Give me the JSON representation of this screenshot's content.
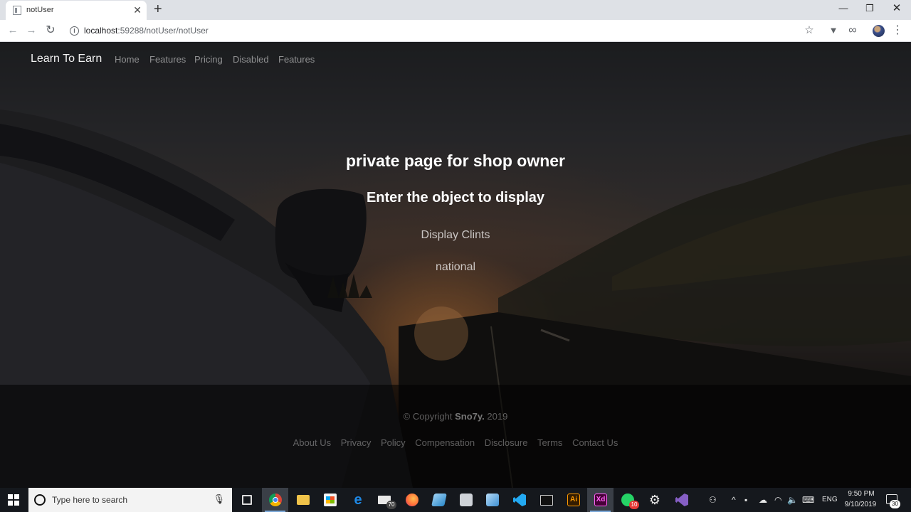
{
  "browser": {
    "tab_title": "notUser",
    "tab_close_glyph": "✕",
    "new_tab_glyph": "+",
    "url_host": "localhost",
    "url_path": ":59288/notUser/notUser",
    "window_controls": {
      "minimize": "—",
      "maximize": "❐",
      "close": "✕"
    },
    "icons": [
      "back-arrow-icon",
      "forward-arrow-icon",
      "reload-icon",
      "info-icon",
      "star-icon",
      "extension-icon",
      "infinity-extension-icon",
      "profile-avatar",
      "kebab-menu-icon"
    ]
  },
  "page": {
    "brand": "Learn To Earn",
    "nav": [
      "Home",
      "Features",
      "Pricing",
      "Disabled",
      "Features"
    ],
    "hero": {
      "title": "private page for shop owner",
      "subtitle": "Enter the object to display",
      "links": [
        "Display Clints",
        "national"
      ]
    },
    "footer": {
      "copyright_prefix": "© Copyright ",
      "copyright_name": "Sno7y.",
      "copyright_year": " 2019",
      "links": [
        "About Us",
        "Privacy",
        "Policy",
        "Compensation",
        "Disclosure",
        "Terms",
        "Contact Us"
      ]
    }
  },
  "taskbar": {
    "search_placeholder": "Type here to search",
    "mail_badge": "70",
    "whatsapp_badge": "10",
    "language": "ENG",
    "time": "9:50 PM",
    "date": "9/10/2019",
    "notification_count": "30",
    "apps": [
      "chrome",
      "file-explorer",
      "store",
      "edge",
      "mail",
      "firefox",
      "app-blue",
      "app-gray",
      "app-3d",
      "vscode",
      "terminal",
      "illustrator",
      "adobe-xd",
      "whatsapp",
      "settings",
      "visual-studio"
    ]
  },
  "colors": {
    "chrome_tabbar": "#dee1e6",
    "taskbar": "#15181d",
    "nav_link": "#9a9a9a",
    "illustrator": "#ff9a00",
    "xd": "#ff61f6",
    "vscode": "#23a9f2",
    "visual_studio": "#865fc5"
  }
}
